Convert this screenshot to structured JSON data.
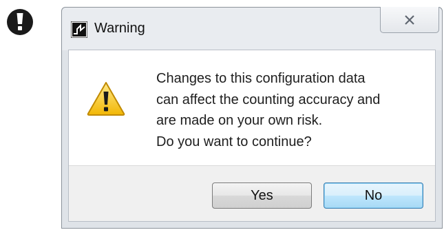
{
  "badge": {
    "icon": "exclamation-icon",
    "symbol": "!"
  },
  "dialog": {
    "title": "Warning",
    "app_icon": "app-signal-icon",
    "close_icon": "close-x-icon",
    "message_icon": "warning-triangle-icon",
    "message": "Changes to this configuration data\ncan affect the counting accuracy and\nare made on your own risk.\nDo you want to continue?",
    "buttons": {
      "yes_label": "Yes",
      "no_label": "No"
    }
  },
  "colors": {
    "badge": "#1a1a1a",
    "warning_yellow": "#f5c60e",
    "default_button_border": "#3c7fb1"
  }
}
